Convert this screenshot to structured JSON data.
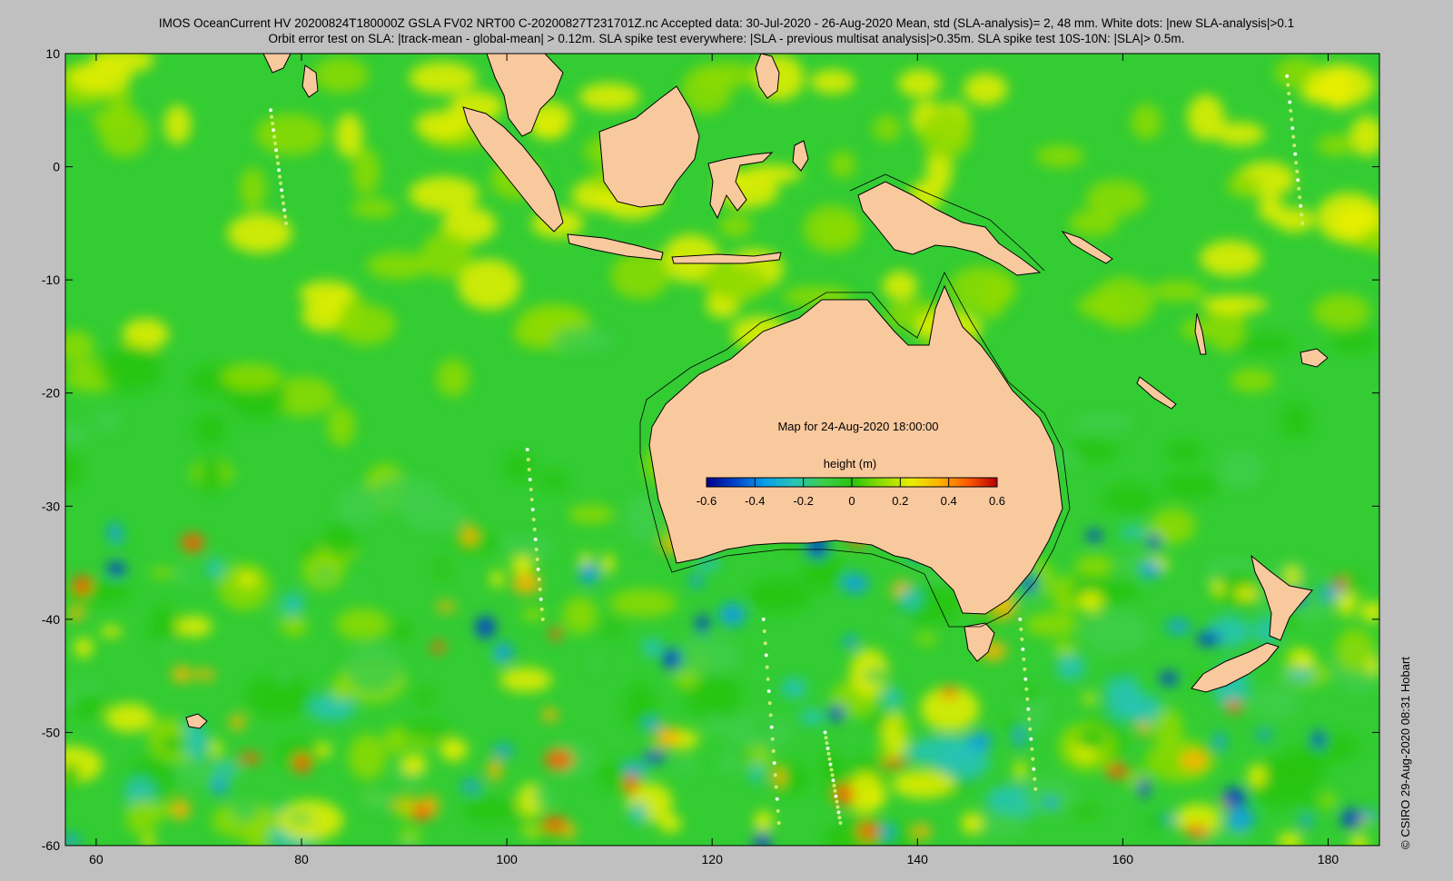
{
  "header": {
    "line1": "IMOS OceanCurrent HV 20200824T180000Z GSLA FV02 NRT00 C-20200827T231701Z.nc  Accepted data: 30-Jul-2020 - 26-Aug-2020 Mean, std (SLA-analysis)= 2, 48 mm. White dots: |new SLA-analysis|>0.1",
    "line2": "Orbit error test on SLA: |track-mean  - global-mean| > 0.12m.  SLA spike test everywhere: |SLA - previous multisat analysis|>0.35m. SLA spike test 10S-10N: |SLA|> 0.5m."
  },
  "map": {
    "lon_range": [
      57,
      185
    ],
    "lat_range": [
      -60,
      10
    ],
    "x_ticks": [
      "60",
      "80",
      "100",
      "120",
      "140",
      "160",
      "180"
    ],
    "y_ticks": [
      "10",
      "0",
      "-10",
      "-20",
      "-30",
      "-40",
      "-50",
      "-60"
    ],
    "map_label": "Map for 24-Aug-2020 18:00:00",
    "colors": {
      "background": "#c0c0c0",
      "ocean_base": "#33cc33",
      "land": "#f9c99e",
      "coast": "#000000"
    }
  },
  "colorbar": {
    "title": "height (m)",
    "ticks": [
      "-0.6",
      "-0.4",
      "-0.2",
      "0",
      "0.2",
      "0.4",
      "0.6"
    ],
    "values": [
      -0.6,
      -0.4,
      -0.2,
      0,
      0.2,
      0.4,
      0.6
    ],
    "colormap": [
      "#00008c",
      "#0044cc",
      "#0a9ee8",
      "#26c3b8",
      "#3fce4a",
      "#27c40f",
      "#8edb00",
      "#e8ee00",
      "#ffb300",
      "#ff5a00",
      "#b40000"
    ]
  },
  "credit": "©  CSIRO 29-Aug-2020 08:31 Hobart"
}
